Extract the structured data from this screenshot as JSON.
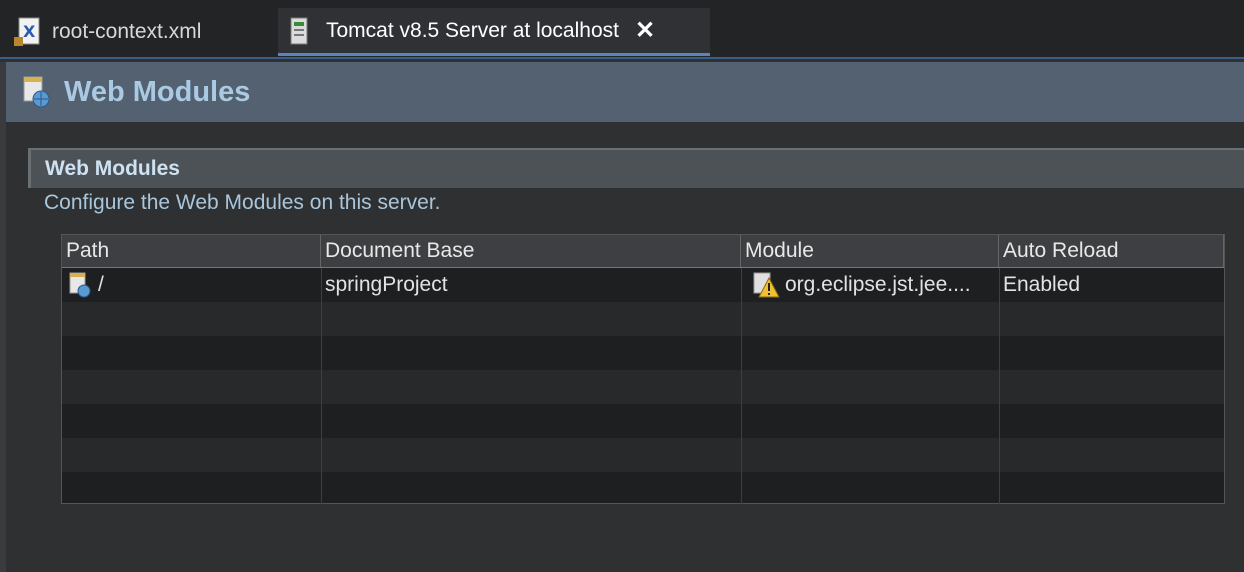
{
  "tabs": [
    {
      "label": "root-context.xml",
      "icon": "xml-file-icon",
      "active": false
    },
    {
      "label": "Tomcat v8.5 Server at localhost",
      "icon": "server-icon",
      "active": true,
      "close_icon": "close-icon"
    }
  ],
  "header": {
    "title": "Web Modules",
    "icon": "web-module-icon"
  },
  "section": {
    "title": "Web Modules",
    "description": "Configure the Web Modules on this server."
  },
  "table": {
    "columns": [
      "Path",
      "Document Base",
      "Module",
      "Auto Reload"
    ],
    "rows": [
      {
        "path": "/",
        "document_base": "springProject",
        "module": "org.eclipse.jst.jee....",
        "auto_reload": "Enabled",
        "path_icon": "web-module-icon",
        "module_icon": "warning-module-icon"
      }
    ]
  },
  "colors": {
    "header_bg": "#536170",
    "header_text": "#aac9e2",
    "active_tab_underline": "#5a84c0"
  }
}
